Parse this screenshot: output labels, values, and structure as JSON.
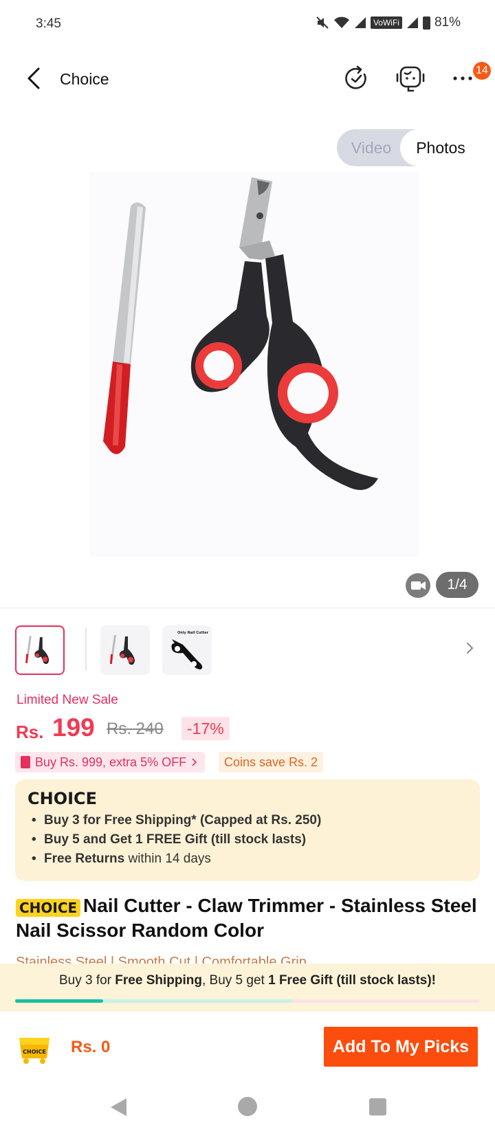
{
  "status_bar": {
    "time": "3:45",
    "vowifi": "VoWiFi",
    "battery": "81%"
  },
  "header": {
    "title": "Choice",
    "cart_badge": "14"
  },
  "media": {
    "toggle_video": "Video",
    "toggle_photos": "Photos",
    "counter": "1/4",
    "thumbnail_text": "Only Nail Cutter"
  },
  "pricing": {
    "sale_label": "Limited New Sale",
    "currency": "Rs.",
    "price": "199",
    "original_price": "Rs. 240",
    "discount": "-17%",
    "promo": "Buy Rs. 999, extra 5% OFF",
    "coins": "Coins save Rs. 2"
  },
  "choice_box": {
    "logo": "CHOICE",
    "items": [
      {
        "bold": "Buy 3 for  Free Shipping* (Capped at Rs. 250)",
        "rest": ""
      },
      {
        "bold": "Buy 5 and Get 1 FREE Gift (till stock lasts)",
        "rest": ""
      },
      {
        "bold": "Free Returns",
        "rest": " within 14 days"
      }
    ]
  },
  "product": {
    "tag": "CHOICE",
    "title": "Nail Cutter - Claw Trimmer - Stainless Steel Nail Scissor Random Color",
    "features": "Stainless Steel  |  Smooth Cut  |  Comfortable Grip"
  },
  "shipping_banner": {
    "part1": "Buy 3 for ",
    "part2": "Free Shipping",
    "part3": ", Buy 5 get ",
    "part4": "1 Free Gift (till stock lasts)!",
    "progress": 0.19
  },
  "bottom_bar": {
    "cart_label": "CHOICE",
    "total": "Rs. 0",
    "add_button": "Add To My Picks"
  },
  "colors": {
    "accent": "#f85a16",
    "price": "#f23a52",
    "choice_bg": "#fdf2d6",
    "progress": "#18bfa2"
  },
  "icons": [
    "back-icon",
    "refresh-icon",
    "support-bot-icon",
    "more-icon",
    "video-camera-icon",
    "chevron-right-icon",
    "choice-cart-icon"
  ]
}
